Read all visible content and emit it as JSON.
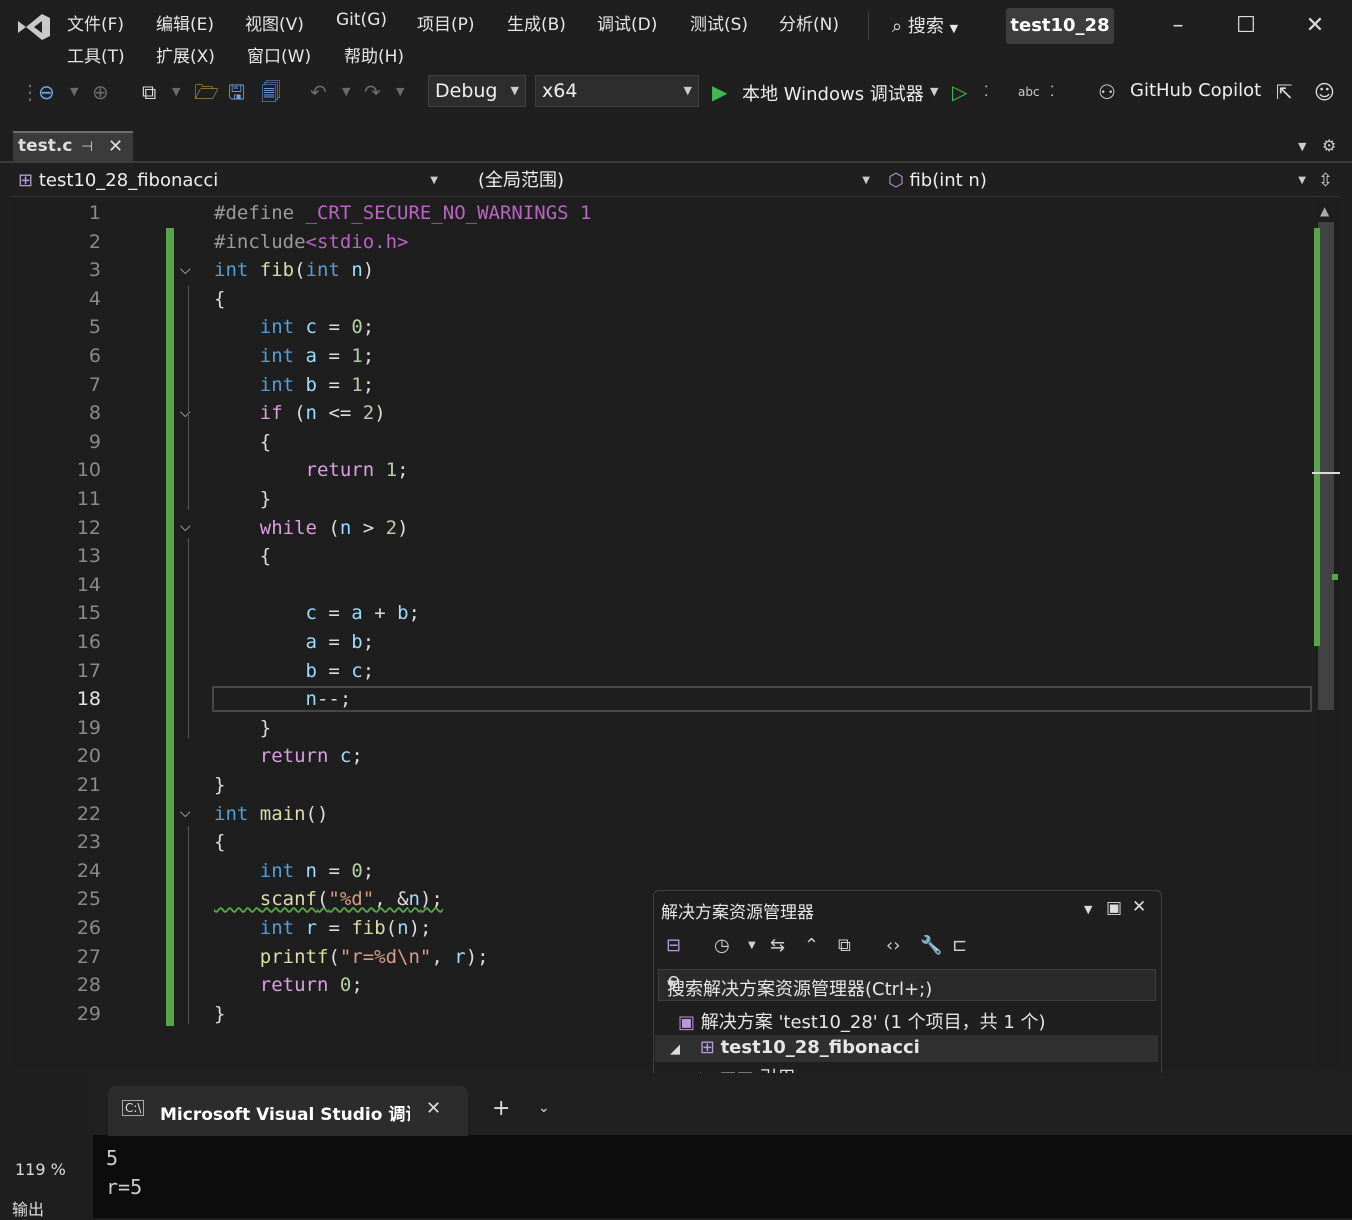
{
  "menu_row1": [
    "文件(F)",
    "编辑(E)",
    "视图(V)",
    "Git(G)",
    "项目(P)",
    "生成(B)",
    "调试(D)",
    "测试(S)",
    "分析(N)"
  ],
  "menu_row2": [
    "工具(T)",
    "扩展(X)",
    "窗口(W)",
    "帮助(H)"
  ],
  "search_label": "搜索",
  "solution_name": "test10_28",
  "toolbar": {
    "config": "Debug",
    "platform": "x64",
    "run_label": "本地 Windows 调试器",
    "copilot": "GitHub Copilot"
  },
  "tab": {
    "filename": "test.c"
  },
  "navbar": {
    "project": "test10_28_fibonacci",
    "scope": "(全局范围)",
    "member": "fib(int n)"
  },
  "editor": {
    "line_numbers": [
      "1",
      "2",
      "3",
      "4",
      "5",
      "6",
      "7",
      "8",
      "9",
      "10",
      "11",
      "12",
      "13",
      "14",
      "15",
      "16",
      "17",
      "18",
      "19",
      "20",
      "21",
      "22",
      "23",
      "24",
      "25",
      "26",
      "27",
      "28",
      "29"
    ],
    "current_line": "18",
    "lines": [
      "#define _CRT_SECURE_NO_WARNINGS 1",
      "#include<stdio.h>",
      "int fib(int n)",
      "{",
      "    int c = 0;",
      "    int a = 1;",
      "    int b = 1;",
      "    if (n <= 2)",
      "    {",
      "        return 1;",
      "    }",
      "    while (n > 2)",
      "    {",
      "",
      "        c = a + b;",
      "        a = b;",
      "        b = c;",
      "        n--;",
      "    }",
      "    return c;",
      "}",
      "int main()",
      "{",
      "    int n = 0;",
      "    scanf(\"%d\", &n);",
      "    int r = fib(n);",
      "    printf(\"r=%d\\n\", r);",
      "    return 0;",
      "}"
    ]
  },
  "solution_explorer": {
    "title": "解决方案资源管理器",
    "search_placeholder": "搜索解决方案资源管理器(Ctrl+;)",
    "solution_row": "解决方案 'test10_28' (1 个项目，共 1 个)",
    "project_row": "test10_28_fibonacci",
    "refs_row": "引用"
  },
  "terminal": {
    "tab_title": "Microsoft Visual Studio 调试控",
    "output_lines": [
      "5",
      "r=5"
    ]
  },
  "status": {
    "zoom": "119 %",
    "output_tab": "输出"
  },
  "colors": {
    "accent": "#57a64a",
    "keyword": "#569cd6",
    "control_keyword": "#d8a0df",
    "number": "#b5cea8",
    "string": "#d69d85",
    "function": "#dcdcaa",
    "variable": "#9cdcfe"
  }
}
